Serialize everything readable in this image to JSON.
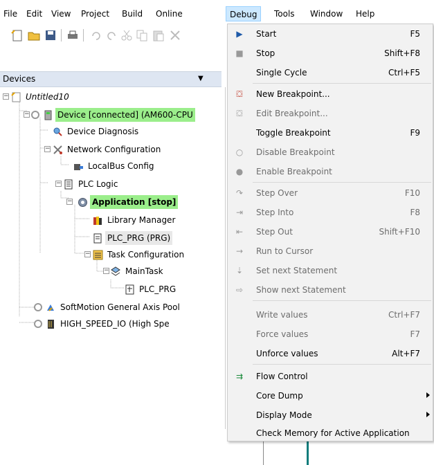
{
  "menubar": {
    "items": [
      "File",
      "Edit",
      "View",
      "Project",
      "Build",
      "Online",
      "Debug",
      "Tools",
      "Window",
      "Help"
    ]
  },
  "devices_panel": {
    "title": "Devices",
    "tree": [
      {
        "label": "Untitled10"
      },
      {
        "label": "Device [connected] (AM600-CPU"
      },
      {
        "label": "Device Diagnosis"
      },
      {
        "label": "Network Configuration"
      },
      {
        "label": "LocalBus Config"
      },
      {
        "label": "PLC Logic"
      },
      {
        "label": "Application [stop]"
      },
      {
        "label": "Library Manager"
      },
      {
        "label": "PLC_PRG (PRG)"
      },
      {
        "label": "Task Configuration"
      },
      {
        "label": "MainTask"
      },
      {
        "label": "PLC_PRG"
      },
      {
        "label": "SoftMotion General Axis Pool"
      },
      {
        "label": "HIGH_SPEED_IO (High Spe"
      }
    ]
  },
  "debug_menu": {
    "items": [
      {
        "label": "Start",
        "shortcut": "F5"
      },
      {
        "label": "Stop",
        "shortcut": "Shift+F8"
      },
      {
        "label": "Single Cycle",
        "shortcut": "Ctrl+F5"
      },
      {
        "label": "New Breakpoint...",
        "shortcut": ""
      },
      {
        "label": "Edit Breakpoint...",
        "shortcut": ""
      },
      {
        "label": "Toggle Breakpoint",
        "shortcut": "F9"
      },
      {
        "label": "Disable Breakpoint",
        "shortcut": ""
      },
      {
        "label": "Enable Breakpoint",
        "shortcut": ""
      },
      {
        "label": "Step Over",
        "shortcut": "F10"
      },
      {
        "label": "Step Into",
        "shortcut": "F8"
      },
      {
        "label": "Step Out",
        "shortcut": "Shift+F10"
      },
      {
        "label": "Run to Cursor",
        "shortcut": ""
      },
      {
        "label": "Set next Statement",
        "shortcut": ""
      },
      {
        "label": "Show next Statement",
        "shortcut": ""
      },
      {
        "label": "Write values",
        "shortcut": "Ctrl+F7"
      },
      {
        "label": "Force values",
        "shortcut": "F7"
      },
      {
        "label": "Unforce values",
        "shortcut": "Alt+F7"
      },
      {
        "label": "Flow Control",
        "shortcut": ""
      },
      {
        "label": "Core Dump",
        "shortcut": ""
      },
      {
        "label": "Display Mode",
        "shortcut": ""
      },
      {
        "label": "Check Memory for Active Application",
        "shortcut": ""
      }
    ]
  },
  "colors": {
    "connected_highlight": "#9bee8b",
    "menu_active": "#cce8ff",
    "menu_bg": "#f2f2f2"
  }
}
